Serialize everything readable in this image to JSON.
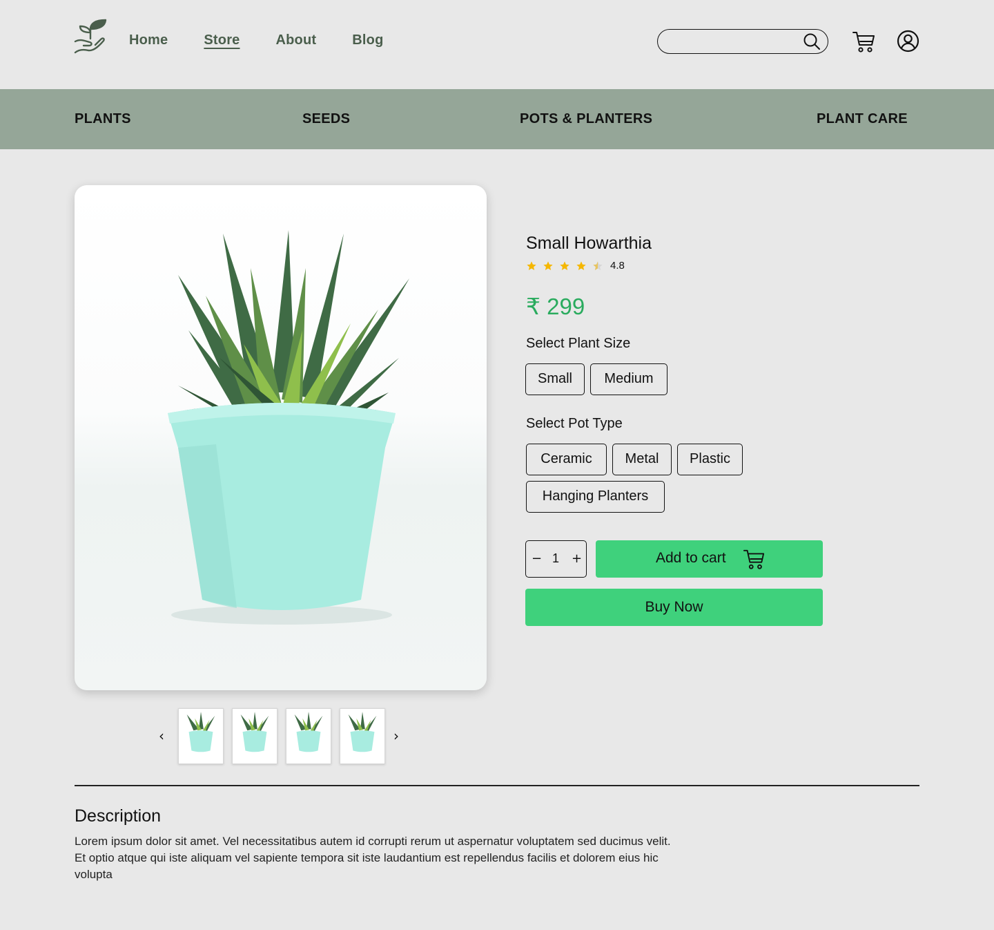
{
  "header": {
    "nav": [
      "Home",
      "Store",
      "About",
      "Blog"
    ],
    "active_nav": "Store",
    "search_placeholder": ""
  },
  "categories": [
    "PLANTS",
    "SEEDS",
    "POTS & PLANTERS",
    "PLANT CARE"
  ],
  "product": {
    "name": "Small Howarthia",
    "rating": "4.8",
    "stars_filled": 4,
    "stars_total": 5,
    "price": "₹ 299",
    "size_label": "Select Plant Size",
    "sizes": [
      "Small",
      "Medium"
    ],
    "pot_label": "Select Pot Type",
    "pots": [
      "Ceramic",
      "Metal",
      "Plastic",
      "Hanging Planters"
    ],
    "quantity": "1",
    "qty_minus": "−",
    "qty_plus": "+",
    "add_to_cart": "Add to cart",
    "buy_now": "Buy Now",
    "thumb_prev": "‹",
    "thumb_next": "›"
  },
  "description": {
    "title": "Description",
    "text": "Lorem ipsum dolor sit amet. Vel necessitatibus autem id corrupti rerum ut aspernatur voluptatem sed ducimus velit. Et optio atque qui iste aliquam vel sapiente tempora sit iste laudantium est repellendus facilis et dolorem eius hic volupta"
  },
  "colors": {
    "background": "#e8e8e8",
    "category_bar": "#95a698",
    "accent_green": "#3fd17c",
    "price_green": "#2aab5e",
    "nav_text": "#4a5e4c",
    "star": "#f5b700",
    "pot": "#a8ece0"
  },
  "icons": [
    "seedling-hand-logo",
    "search-icon",
    "cart-icon",
    "user-icon",
    "star-icon"
  ]
}
